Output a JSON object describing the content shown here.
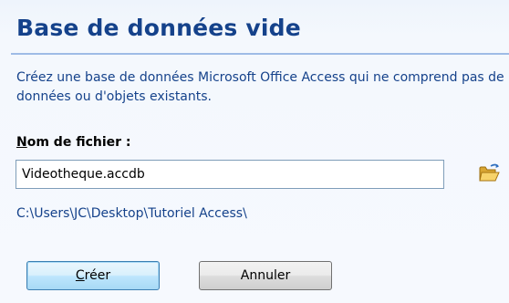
{
  "dialog": {
    "title": "Base de données vide",
    "description": "Créez une base de données Microsoft Office Access qui ne comprend pas de données ou d'objets existants.",
    "filename_label_mnemonic": "N",
    "filename_label_rest": "om de fichier :",
    "filename_value": "Videotheque.accdb",
    "path": "C:\\Users\\JC\\Desktop\\Tutoriel Access\\",
    "folder_icon": "open-folder-icon"
  },
  "buttons": {
    "create_mnemonic": "C",
    "create_rest": "réer",
    "cancel_label": "Annuler"
  },
  "colors": {
    "title": "#15428b",
    "text": "#15428b",
    "rule": "#9ebbe6",
    "background": "#f4f8fd"
  }
}
